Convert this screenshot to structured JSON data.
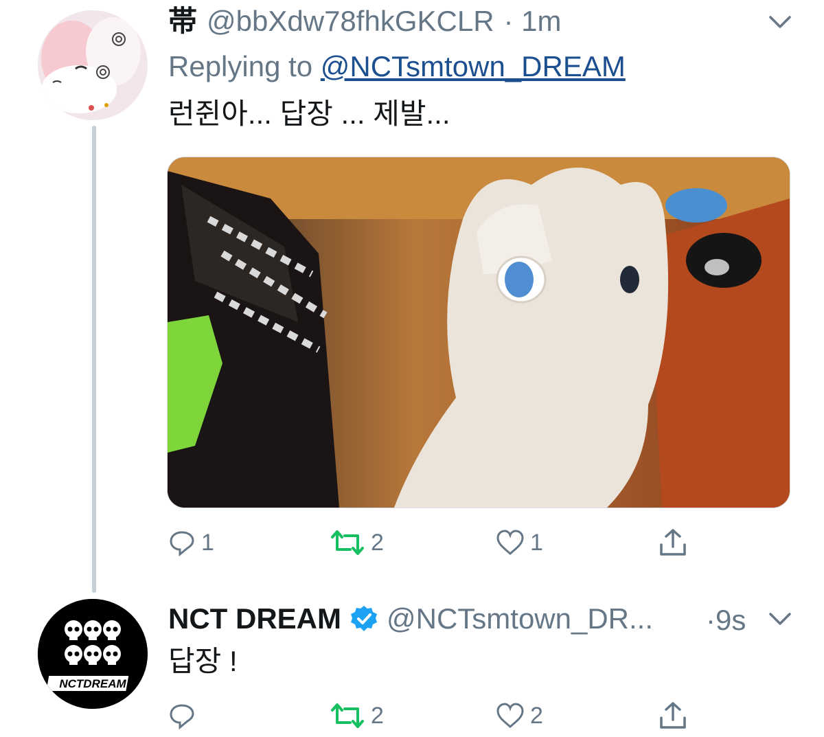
{
  "tweet1": {
    "display_name": "帯",
    "handle": "@bbXdw78fhkGKCLR",
    "dot_time": "· 1m",
    "replying_prefix": "Replying to",
    "replying_handle": "@NCTsmtown_DREAM",
    "text": "런쥔아... 답장 ... 제발...",
    "actions": {
      "reply": "1",
      "retweet": "2",
      "like": "1"
    },
    "avatar_icon": "anime-plush-avatar",
    "media_icon": "white-plush-photo"
  },
  "tweet2": {
    "display_name": "NCT DREAM",
    "verified_icon": "verified-badge-icon",
    "handle": "@NCTsmtown_DR...",
    "dot_time": "·9s",
    "text": "답장 !",
    "actions": {
      "reply": "",
      "retweet": "2",
      "like": "2"
    },
    "avatar_logo_text": "NCTDREAM"
  },
  "colors": {
    "retweet_green": "#17bf63",
    "muted": "#657786",
    "verified_blue": "#1da1f2",
    "link": "#1b4f8f"
  }
}
